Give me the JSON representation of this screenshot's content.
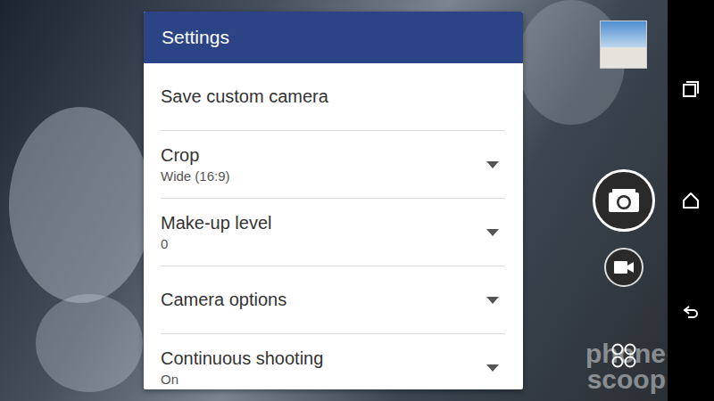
{
  "settings": {
    "title": "Settings",
    "items": [
      {
        "label": "Save custom camera",
        "kind": "action"
      },
      {
        "label": "Crop",
        "value": "Wide (16:9)",
        "kind": "dropdown"
      },
      {
        "label": "Make-up level",
        "value": "0",
        "kind": "dropdown"
      },
      {
        "label": "Camera options",
        "kind": "dropdown"
      },
      {
        "label": "Continuous shooting",
        "value": "On",
        "kind": "dropdown"
      }
    ]
  },
  "watermark": [
    "phone",
    "scoop"
  ]
}
